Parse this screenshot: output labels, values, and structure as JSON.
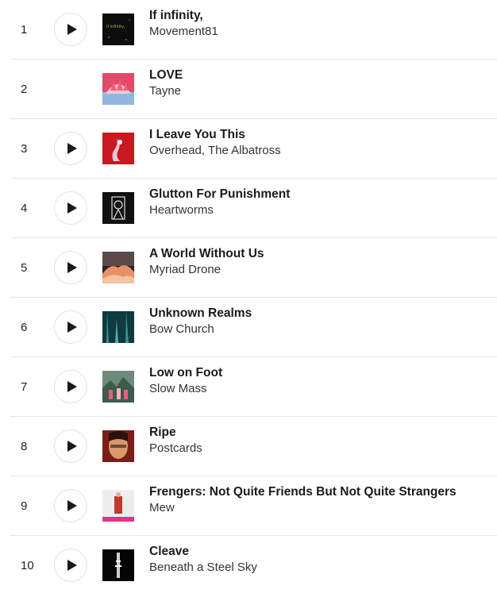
{
  "tracks": [
    {
      "rank": "1",
      "title": "If infinity,",
      "artist": "Movement81",
      "has_play": true,
      "play_icon": "play-icon",
      "art": {
        "bg": "#0d0d0d",
        "accent": "#c8b24a",
        "caption": "if infinity,"
      }
    },
    {
      "rank": "2",
      "title": "LOVE",
      "artist": "Tayne",
      "has_play": false,
      "play_icon": "play-icon",
      "art": {
        "bg": "#e24a6a",
        "accent": "#ffd2dc",
        "caption": ""
      }
    },
    {
      "rank": "3",
      "title": "I Leave You This",
      "artist": "Overhead, The Albatross",
      "has_play": true,
      "play_icon": "play-icon",
      "art": {
        "bg": "#c9181f",
        "accent": "#f4c6d8",
        "caption": ""
      }
    },
    {
      "rank": "4",
      "title": "Glutton For Punishment",
      "artist": "Heartworms",
      "has_play": true,
      "play_icon": "play-icon",
      "art": {
        "bg": "#111111",
        "accent": "#e0e0e0",
        "caption": ""
      }
    },
    {
      "rank": "5",
      "title": "A World Without Us",
      "artist": "Myriad Drone",
      "has_play": true,
      "play_icon": "play-icon",
      "art": {
        "bg": "#2b2220",
        "accent": "#e8906a",
        "caption": ""
      }
    },
    {
      "rank": "6",
      "title": "Unknown Realms",
      "artist": "Bow Church",
      "has_play": true,
      "play_icon": "play-icon",
      "art": {
        "bg": "#0f3a40",
        "accent": "#3fa6a8",
        "caption": ""
      }
    },
    {
      "rank": "7",
      "title": "Low on Foot",
      "artist": "Slow Mass",
      "has_play": true,
      "play_icon": "play-icon",
      "art": {
        "bg": "#6e8a7a",
        "accent": "#d9dfd9",
        "caption": ""
      }
    },
    {
      "rank": "8",
      "title": "Ripe",
      "artist": "Postcards",
      "has_play": true,
      "play_icon": "play-icon",
      "art": {
        "bg": "#7a1e17",
        "accent": "#d89a6a",
        "caption": ""
      }
    },
    {
      "rank": "9",
      "title": "Frengers: Not Quite Friends But Not Quite Strangers",
      "artist": "Mew",
      "has_play": true,
      "play_icon": "play-icon",
      "art": {
        "bg": "#ededed",
        "accent": "#e0338a",
        "caption": ""
      }
    },
    {
      "rank": "10",
      "title": "Cleave",
      "artist": "Beneath a Steel Sky",
      "has_play": true,
      "play_icon": "play-icon",
      "art": {
        "bg": "#050505",
        "accent": "#cfcfcf",
        "caption": ""
      }
    }
  ]
}
